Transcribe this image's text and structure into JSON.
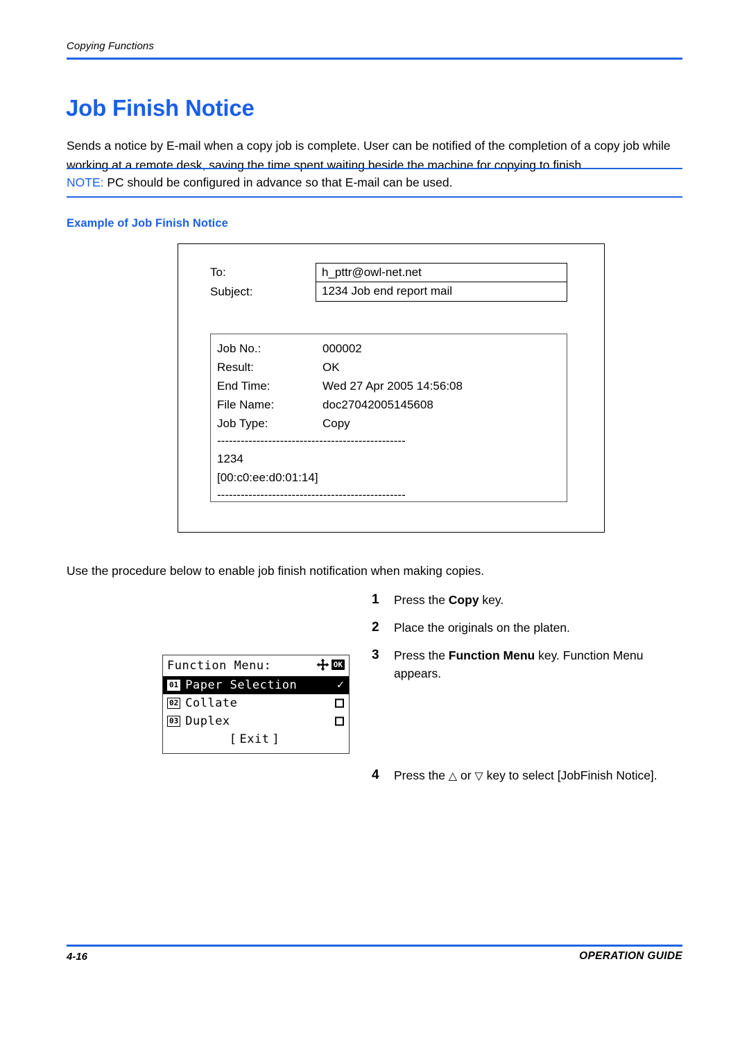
{
  "header": {
    "running_title": "Copying Functions"
  },
  "page": {
    "title": "Job Finish Notice",
    "intro": "Sends a notice by E-mail when a copy job is complete. User can be notified of the completion of a copy job while working at a remote desk, saving the time spent waiting beside the machine for copying to finish.",
    "procedure_intro": "Use the procedure below to enable job finish notification when making copies."
  },
  "note": {
    "label": "NOTE:",
    "text": "PC should be configured in advance so that E-mail can be used."
  },
  "example": {
    "heading": "Example of Job Finish Notice",
    "mail_fields": [
      {
        "key": "To:",
        "value": "h_pttr@owl-net.net"
      },
      {
        "key": "Subject:",
        "value": "1234 Job end report mail"
      }
    ],
    "report": {
      "rows": [
        {
          "key": "Job No.:",
          "value": "000002"
        },
        {
          "key": "Result:",
          "value": "OK"
        },
        {
          "key": "End Time:",
          "value": "Wed 27 Apr 2005 14:56:08"
        },
        {
          "key": "File Name:",
          "value": "doc27042005145608"
        },
        {
          "key": "Job Type:",
          "value": "Copy"
        }
      ],
      "separator_top": "------------------------------------------------",
      "device_name": "1234",
      "device_mac": "[00:c0:ee:d0:01:14]",
      "separator_bottom": "------------------------------------------------"
    }
  },
  "steps": [
    {
      "num": "1",
      "pre": "Press the ",
      "bold": "Copy",
      "post": " key."
    },
    {
      "num": "2",
      "pre": "Place the originals on the platen.",
      "bold": "",
      "post": ""
    },
    {
      "num": "3",
      "pre": "Press the ",
      "bold": "Function Menu",
      "post": " key. Function Menu appears."
    }
  ],
  "step4": {
    "num": "4",
    "pre": "Press the ",
    "up_arrow": "△",
    "mid": " or ",
    "down_arrow": "▽",
    "post": " key to select [JobFinish Notice]."
  },
  "lcd": {
    "title": "Function Menu:",
    "ok_key": "OK",
    "nav_icon": "four-way-arrow-icon",
    "items": [
      {
        "badge": "01",
        "label": "Paper Selection",
        "state": "checked",
        "selected": true
      },
      {
        "badge": "02",
        "label": "Collate",
        "state": "unchecked",
        "selected": false
      },
      {
        "badge": "03",
        "label": "Duplex",
        "state": "unchecked",
        "selected": false
      }
    ],
    "exit_open": "[",
    "exit_label": "Exit",
    "exit_close": "]",
    "check_glyph": "✓"
  },
  "footer": {
    "page_number": "4-16",
    "guide_label": "OPERATION GUIDE"
  },
  "colors": {
    "accent_blue": "#1a5fe8",
    "rule_blue": "#1f64e0",
    "text_black": "#000000"
  }
}
